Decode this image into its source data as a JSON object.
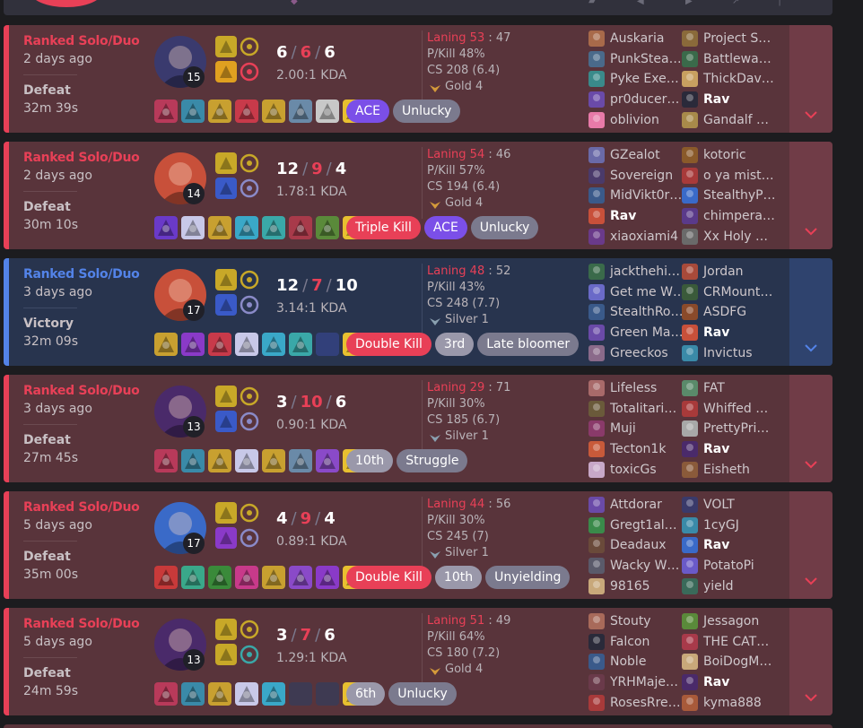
{
  "top_icons": [
    "swords-icon",
    "shield-icon",
    "share-icon",
    "arrow-icon",
    "more-icon"
  ],
  "matches": [
    {
      "result_type": "defeat",
      "queue": "Ranked Solo/Duo",
      "ago": "2 days ago",
      "result": "Defeat",
      "duration": "32m 39s",
      "level": "15",
      "champ_color": "#3a3a6e",
      "spell_colors": [
        "#c8a828",
        "#e0a020"
      ],
      "rune_colors": [
        "#c8a828",
        "#e84057"
      ],
      "kills": "6",
      "deaths": "6",
      "assists": "6",
      "kda_ratio": "2.00:1 KDA",
      "laning_label": "Laning 53",
      "laning_vs": "47",
      "pkill": "P/Kill 48%",
      "cs": "CS 208 (6.4)",
      "rank": "Gold 4",
      "rank_color": "#d49a3a",
      "items": [
        "#b83a5a",
        "#3a8aa8",
        "#c8a030",
        "#c83a4a",
        "#c8a030",
        "#6a8aa8",
        "#c8c8c8",
        "#e8c030"
      ],
      "badges": [
        {
          "label": "ACE",
          "style": "purple"
        },
        {
          "label": "Unlucky",
          "style": "gray"
        }
      ],
      "team1": [
        {
          "name": "Auskaria",
          "color": "#a86a4a"
        },
        {
          "name": "PunkStea…",
          "color": "#4a6a8a"
        },
        {
          "name": "Pyke Exe…",
          "color": "#3a8a8a"
        },
        {
          "name": "pr0ducer…",
          "color": "#6a4aa8"
        },
        {
          "name": "oblivion",
          "color": "#e87aa8"
        }
      ],
      "team2": [
        {
          "name": "Project S…",
          "color": "#8a6a3a"
        },
        {
          "name": "Battlewa…",
          "color": "#3a6a4a"
        },
        {
          "name": "ThickDav…",
          "color": "#c8a060"
        },
        {
          "name": "Rav",
          "color": "#2a2a3a",
          "me": true
        },
        {
          "name": "Gandalf …",
          "color": "#a88a4a"
        }
      ]
    },
    {
      "result_type": "defeat",
      "queue": "Ranked Solo/Duo",
      "ago": "2 days ago",
      "result": "Defeat",
      "duration": "30m 10s",
      "level": "14",
      "champ_color": "#c8503a",
      "spell_colors": [
        "#c8a828",
        "#3a5ac8"
      ],
      "rune_colors": [
        "#c8a828",
        "#8a8ac8"
      ],
      "kills": "12",
      "deaths": "9",
      "assists": "4",
      "kda_ratio": "1.78:1 KDA",
      "laning_label": "Laning 54",
      "laning_vs": "46",
      "pkill": "P/Kill 57%",
      "cs": "CS 194 (6.4)",
      "rank": "Gold 4",
      "rank_color": "#d49a3a",
      "items": [
        "#6a3ac8",
        "#c8c8e8",
        "#c8a030",
        "#3aa8c8",
        "#3aa8a8",
        "#a83a4a",
        "#5a8a3a",
        "#e8c030"
      ],
      "badges": [
        {
          "label": "Triple Kill",
          "style": "red"
        },
        {
          "label": "ACE",
          "style": "purple"
        },
        {
          "label": "Unlucky",
          "style": "gray"
        }
      ],
      "team1": [
        {
          "name": "GZealot",
          "color": "#6a6aa8"
        },
        {
          "name": "Sovereign",
          "color": "#4a3a6a"
        },
        {
          "name": "MidVikt0r…",
          "color": "#3a5a8a"
        },
        {
          "name": "Rav",
          "color": "#c8503a",
          "me": true
        },
        {
          "name": "xiaoxiami4",
          "color": "#6a3a8a"
        }
      ],
      "team2": [
        {
          "name": "kotoric",
          "color": "#8a5a2a"
        },
        {
          "name": "o ya mist…",
          "color": "#a83a3a"
        },
        {
          "name": "StealthyP…",
          "color": "#3a6ac8"
        },
        {
          "name": "chimpera…",
          "color": "#5a3a8a"
        },
        {
          "name": "Xx Holy …",
          "color": "#6a6a6a"
        }
      ]
    },
    {
      "result_type": "victory",
      "queue": "Ranked Solo/Duo",
      "ago": "3 days ago",
      "result": "Victory",
      "duration": "32m 09s",
      "level": "17",
      "champ_color": "#c8503a",
      "spell_colors": [
        "#c8a828",
        "#3a5ac8"
      ],
      "rune_colors": [
        "#c8a828",
        "#8a8ac8"
      ],
      "kills": "12",
      "deaths": "7",
      "assists": "10",
      "kda_ratio": "3.14:1 KDA",
      "laning_label": "Laning 48",
      "laning_vs": "52",
      "pkill": "P/Kill 43%",
      "cs": "CS 248 (7.7)",
      "rank": "Silver 1",
      "rank_color": "#8aa0b0",
      "items": [
        "#c8a030",
        "#8a3ac8",
        "#c83a4a",
        "#c8c8e8",
        "#3aa8c8",
        "#3aa8a8",
        null,
        "#e8c030"
      ],
      "badges": [
        {
          "label": "Double Kill",
          "style": "red"
        },
        {
          "label": "3rd",
          "style": "gray-light"
        },
        {
          "label": "Late bloomer",
          "style": "gray"
        }
      ],
      "team1": [
        {
          "name": "jackthehi…",
          "color": "#3a6a4a"
        },
        {
          "name": "Get me W…",
          "color": "#6a6ac8"
        },
        {
          "name": "StealthRo…",
          "color": "#3a5a8a"
        },
        {
          "name": "Green Ma…",
          "color": "#6a4aa8"
        },
        {
          "name": "Greeckos",
          "color": "#8a6a8a"
        }
      ],
      "team2": [
        {
          "name": "Jordan",
          "color": "#a84a3a"
        },
        {
          "name": "CRMount…",
          "color": "#3a5a3a"
        },
        {
          "name": "ASDFG",
          "color": "#8a4a2a"
        },
        {
          "name": "Rav",
          "color": "#c8503a",
          "me": true
        },
        {
          "name": "Invictus",
          "color": "#3a8aa8"
        }
      ]
    },
    {
      "result_type": "defeat",
      "queue": "Ranked Solo/Duo",
      "ago": "3 days ago",
      "result": "Defeat",
      "duration": "27m 45s",
      "level": "13",
      "champ_color": "#4a2a6a",
      "spell_colors": [
        "#c8a828",
        "#3a5ac8"
      ],
      "rune_colors": [
        "#c8a828",
        "#8a8ac8"
      ],
      "kills": "3",
      "deaths": "10",
      "assists": "6",
      "kda_ratio": "0.90:1 KDA",
      "laning_label": "Laning 29",
      "laning_vs": "71",
      "pkill": "P/Kill 30%",
      "cs": "CS 185 (6.7)",
      "rank": "Silver 1",
      "rank_color": "#8aa0b0",
      "items": [
        "#b83a5a",
        "#3a8aa8",
        "#c8a030",
        "#c8c8e8",
        "#c8a030",
        "#6a8aa8",
        "#8a4ac8",
        "#e8c030"
      ],
      "badges": [
        {
          "label": "10th",
          "style": "gray-light"
        },
        {
          "label": "Struggle",
          "style": "gray"
        }
      ],
      "team1": [
        {
          "name": "Lifeless",
          "color": "#a86a6a"
        },
        {
          "name": "Totalitari…",
          "color": "#6a5a3a"
        },
        {
          "name": "Muji",
          "color": "#8a3a6a"
        },
        {
          "name": "Tecton1k",
          "color": "#c85a3a"
        },
        {
          "name": "toxicGs",
          "color": "#c8a8c8"
        }
      ],
      "team2": [
        {
          "name": "FAT",
          "color": "#5a8a6a"
        },
        {
          "name": "Whiffed …",
          "color": "#a83a3a"
        },
        {
          "name": "PrettyPri…",
          "color": "#a8a8a8"
        },
        {
          "name": "Rav",
          "color": "#4a2a6a",
          "me": true
        },
        {
          "name": "Eisheth",
          "color": "#8a5a3a"
        }
      ]
    },
    {
      "result_type": "defeat",
      "queue": "Ranked Solo/Duo",
      "ago": "5 days ago",
      "result": "Defeat",
      "duration": "35m 00s",
      "level": "17",
      "champ_color": "#3a6ac8",
      "spell_colors": [
        "#c8a828",
        "#8a3ac8"
      ],
      "rune_colors": [
        "#c8a828",
        "#8a8ac8"
      ],
      "kills": "4",
      "deaths": "9",
      "assists": "4",
      "kda_ratio": "0.89:1 KDA",
      "laning_label": "Laning 44",
      "laning_vs": "56",
      "pkill": "P/Kill 30%",
      "cs": "CS 245 (7)",
      "rank": "Silver 1",
      "rank_color": "#8aa0b0",
      "items": [
        "#c83a3a",
        "#3aa88a",
        "#3a8a3a",
        "#c83a8a",
        "#c8a030",
        "#8a4ac8",
        "#8a3ac8",
        "#e8c030"
      ],
      "badges": [
        {
          "label": "Double Kill",
          "style": "red"
        },
        {
          "label": "10th",
          "style": "gray-light"
        },
        {
          "label": "Unyielding",
          "style": "gray"
        }
      ],
      "team1": [
        {
          "name": "Attdorar",
          "color": "#6a4aa8"
        },
        {
          "name": "Gregt1al…",
          "color": "#3a8a4a"
        },
        {
          "name": "Deadaux",
          "color": "#6a4a3a"
        },
        {
          "name": "Wacky W…",
          "color": "#5a5a6a"
        },
        {
          "name": "98165",
          "color": "#c8a87a"
        }
      ],
      "team2": [
        {
          "name": "VOLT",
          "color": "#3a3a6a"
        },
        {
          "name": "1cyGJ",
          "color": "#3a8aa8"
        },
        {
          "name": "Rav",
          "color": "#3a6ac8",
          "me": true
        },
        {
          "name": "PotatoPi",
          "color": "#6a5ac8"
        },
        {
          "name": "yield",
          "color": "#3a6a5a"
        }
      ]
    },
    {
      "result_type": "defeat",
      "queue": "Ranked Solo/Duo",
      "ago": "5 days ago",
      "result": "Defeat",
      "duration": "24m 59s",
      "level": "13",
      "champ_color": "#4a2a6a",
      "spell_colors": [
        "#c8a828",
        "#c8a828"
      ],
      "rune_colors": [
        "#c8a828",
        "#3aa8a8"
      ],
      "kills": "3",
      "deaths": "7",
      "assists": "6",
      "kda_ratio": "1.29:1 KDA",
      "laning_label": "Laning 51",
      "laning_vs": "49",
      "pkill": "P/Kill 64%",
      "cs": "CS 180 (7.2)",
      "rank": "Gold 4",
      "rank_color": "#d49a3a",
      "items": [
        "#b83a5a",
        "#3a8aa8",
        "#c8a030",
        "#c8c8e8",
        "#3aa8c8",
        null,
        null,
        "#e8c030"
      ],
      "badges": [
        {
          "label": "6th",
          "style": "gray-light"
        },
        {
          "label": "Unlucky",
          "style": "gray"
        }
      ],
      "team1": [
        {
          "name": "Stouty",
          "color": "#a86a5a"
        },
        {
          "name": "Falcon",
          "color": "#2a2a3a"
        },
        {
          "name": "Noble",
          "color": "#3a5a8a"
        },
        {
          "name": "YRHMaje…",
          "color": "#6a3a4a"
        },
        {
          "name": "RosesRre…",
          "color": "#a83a3a"
        }
      ],
      "team2": [
        {
          "name": "Jessagon",
          "color": "#5a8a3a"
        },
        {
          "name": "THE CAT…",
          "color": "#a83a4a"
        },
        {
          "name": "BoiDogM…",
          "color": "#c8a87a"
        },
        {
          "name": "Rav",
          "color": "#4a2a6a",
          "me": true
        },
        {
          "name": "kyma888",
          "color": "#a85a3a"
        }
      ]
    }
  ]
}
